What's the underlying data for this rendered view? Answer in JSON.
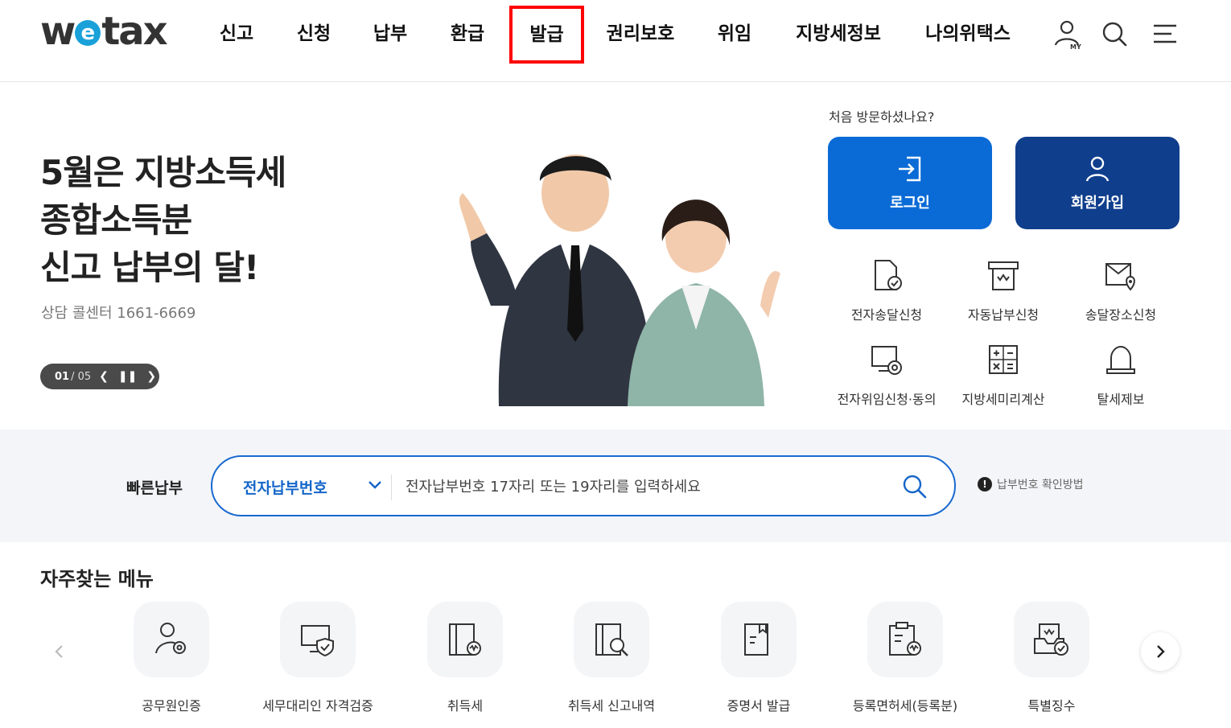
{
  "header": {
    "logo": {
      "pre": "w",
      "mid": "e",
      "post": "tax"
    },
    "nav": [
      {
        "label": "신고"
      },
      {
        "label": "신청"
      },
      {
        "label": "납부"
      },
      {
        "label": "환급"
      },
      {
        "label": "발급",
        "highlighted": true
      },
      {
        "label": "권리보호"
      },
      {
        "label": "위임"
      },
      {
        "label": "지방세정보"
      },
      {
        "label": "나의위택스"
      }
    ],
    "icons": [
      "my-page-icon",
      "search-icon",
      "menu-icon"
    ],
    "my_badge": "MY"
  },
  "hero": {
    "title_lines": [
      "5월은 지방소득세",
      "종합소득분",
      "신고 납부의 달!"
    ],
    "subtitle": "상담 콜센터 1661-6669",
    "slider": {
      "current": "01",
      "total": "/ 05"
    }
  },
  "member": {
    "question": "처음 방문하셨나요?",
    "login_label": "로그인",
    "join_label": "회원가입"
  },
  "quick_menu": [
    {
      "label": "전자송달신청",
      "icon": "e-delivery-icon"
    },
    {
      "label": "자동납부신청",
      "icon": "auto-payment-icon"
    },
    {
      "label": "송달장소신청",
      "icon": "delivery-location-icon"
    },
    {
      "label": "전자위임신청·동의",
      "icon": "e-delegation-icon"
    },
    {
      "label": "지방세미리계산",
      "icon": "calculator-icon"
    },
    {
      "label": "탈세제보",
      "icon": "report-bell-icon"
    }
  ],
  "fast_pay": {
    "label": "빠른납부",
    "select_value": "전자납부번호",
    "placeholder": "전자납부번호 17자리 또는 19자리를 입력하세요",
    "help": "납부번호 확인방법",
    "help_icon_glyph": "!"
  },
  "frequent": {
    "title": "자주찾는 메뉴",
    "items": [
      {
        "label": "공무원인증",
        "icon": "official-cert-icon"
      },
      {
        "label": "세무대리인 자격검증",
        "icon": "agent-verify-icon"
      },
      {
        "label": "취득세",
        "icon": "acquisition-tax-icon"
      },
      {
        "label": "취득세 신고내역",
        "icon": "acquisition-history-icon"
      },
      {
        "label": "증명서 발급",
        "icon": "certificate-icon"
      },
      {
        "label": "등록면허세(등록분)",
        "icon": "registration-tax-icon"
      },
      {
        "label": "특별징수",
        "icon": "special-collection-icon"
      }
    ]
  },
  "colors": {
    "primary": "#0a6bd6",
    "dark_primary": "#0f3e8c",
    "highlight": "#ff0000",
    "band": "#f3f5f8"
  }
}
